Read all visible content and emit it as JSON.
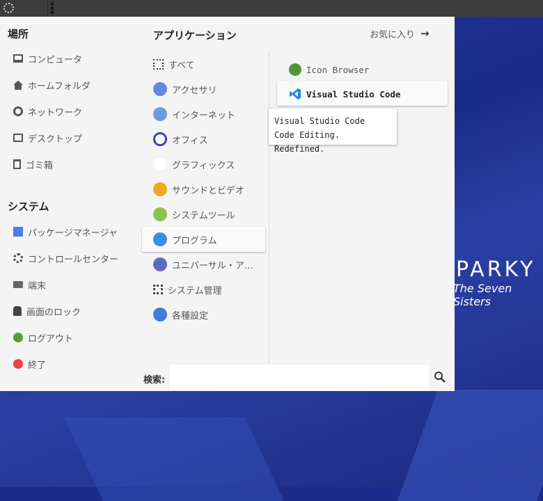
{
  "wallpaper": {
    "title": "PARKY",
    "subtitle": "The Seven Sisters"
  },
  "places": {
    "heading": "場所",
    "items": [
      {
        "label": "コンピュータ",
        "icon": "monitor-icon"
      },
      {
        "label": "ホームフォルダ",
        "icon": "home-icon"
      },
      {
        "label": "ネットワーク",
        "icon": "network-icon"
      },
      {
        "label": "デスクトップ",
        "icon": "desktop-icon"
      },
      {
        "label": "ゴミ箱",
        "icon": "trash-icon"
      }
    ]
  },
  "system": {
    "heading": "システム",
    "items": [
      {
        "label": "パッケージマネージャ",
        "icon": "package-icon"
      },
      {
        "label": "コントロールセンター",
        "icon": "gears-icon"
      },
      {
        "label": "端末",
        "icon": "terminal-icon"
      },
      {
        "label": "画面のロック",
        "icon": "lock-icon"
      },
      {
        "label": "ログアウト",
        "icon": "logout-icon"
      },
      {
        "label": "終了",
        "icon": "power-icon"
      }
    ]
  },
  "applications": {
    "heading": "アプリケーション",
    "favorites_label": "お気に入り",
    "categories": [
      {
        "label": "すべて",
        "color": "#333333"
      },
      {
        "label": "アクセサリ",
        "color": "#6a86e0"
      },
      {
        "label": "インターネット",
        "color": "#6a9be0"
      },
      {
        "label": "オフィス",
        "color": "#3a44b0"
      },
      {
        "label": "グラフィックス",
        "color": "#ffffff"
      },
      {
        "label": "サウンドとビデオ",
        "color": "#f5a623"
      },
      {
        "label": "システムツール",
        "color": "#8bc34a"
      },
      {
        "label": "プログラム",
        "color": "#3b8ee8",
        "selected": true
      },
      {
        "label": "ユニバーサル・ア…",
        "color": "#5c6bc0"
      },
      {
        "label": "システム管理",
        "color": "#444444"
      },
      {
        "label": "各種設定",
        "color": "#3f7dd8"
      }
    ],
    "apps": [
      {
        "label": "Icon Browser",
        "icon": "icon-browser-icon",
        "color": "#4a9a3a"
      },
      {
        "label": "Visual Studio Code",
        "icon": "vscode-icon",
        "color": "#1e88e5",
        "selected": true
      }
    ]
  },
  "tooltip": {
    "line1": "Visual Studio Code",
    "line2": "Code Editing. Redefined."
  },
  "search": {
    "label": "検索:",
    "value": "",
    "placeholder": ""
  }
}
